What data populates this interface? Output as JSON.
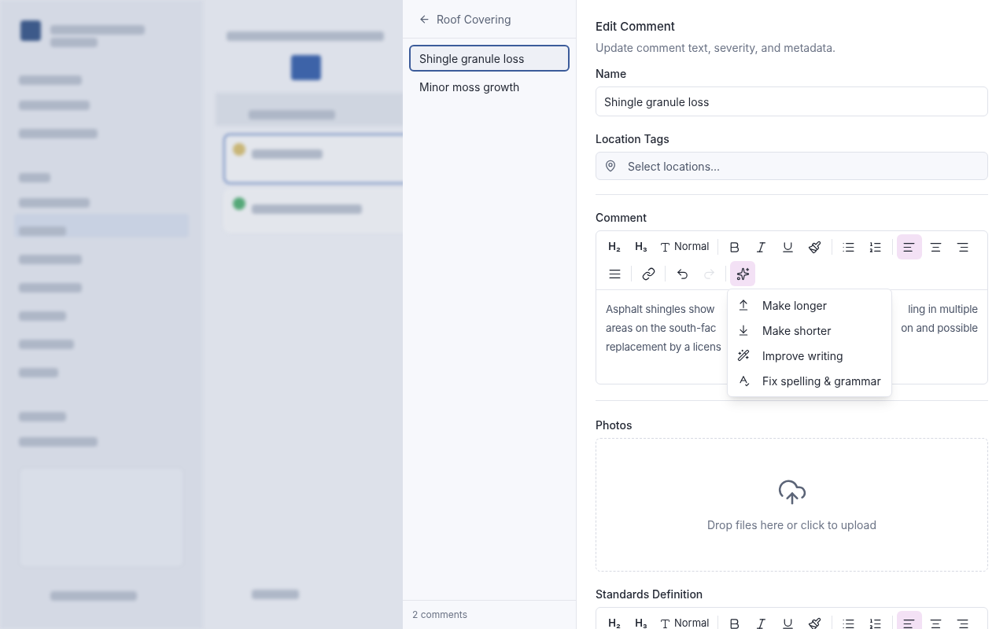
{
  "list_panel": {
    "back_label": "Roof Covering",
    "items": [
      {
        "label": "Shingle granule loss",
        "selected": true
      },
      {
        "label": "Minor moss growth",
        "selected": false
      }
    ],
    "footer": "2 comments"
  },
  "editor": {
    "title": "Edit Comment",
    "subtitle": "Update comment text, severity, and metadata.",
    "name_field": {
      "label": "Name",
      "value": "Shingle granule loss"
    },
    "location_field": {
      "label": "Location Tags",
      "placeholder": "Select locations..."
    },
    "comment": {
      "label": "Comment",
      "toolbar": [
        {
          "kind": "h2",
          "text": "H₂",
          "selected": false,
          "disabled": false
        },
        {
          "kind": "h3",
          "text": "H₃",
          "selected": false,
          "disabled": false
        },
        {
          "kind": "normal",
          "text": "Normal",
          "selected": false,
          "disabled": false
        },
        {
          "kind": "sep"
        },
        {
          "kind": "bold",
          "selected": false,
          "disabled": false
        },
        {
          "kind": "italic",
          "selected": false,
          "disabled": false
        },
        {
          "kind": "underline",
          "selected": false,
          "disabled": false
        },
        {
          "kind": "brush",
          "selected": false,
          "disabled": false
        },
        {
          "kind": "sep"
        },
        {
          "kind": "bullets",
          "selected": false,
          "disabled": false
        },
        {
          "kind": "numbers",
          "selected": false,
          "disabled": false
        },
        {
          "kind": "sep"
        },
        {
          "kind": "align-left",
          "selected": true,
          "disabled": false
        },
        {
          "kind": "align-center",
          "selected": false,
          "disabled": false
        },
        {
          "kind": "align-right",
          "selected": false,
          "disabled": false
        },
        {
          "kind": "justify",
          "selected": false,
          "disabled": false
        },
        {
          "kind": "sep"
        },
        {
          "kind": "link",
          "selected": false,
          "disabled": false
        },
        {
          "kind": "sep"
        },
        {
          "kind": "undo",
          "selected": false,
          "disabled": false
        },
        {
          "kind": "redo",
          "selected": false,
          "disabled": true
        },
        {
          "kind": "sep"
        },
        {
          "kind": "ai",
          "selected": true,
          "disabled": false
        }
      ],
      "text_lines": [
        "Asphalt shingles show",
        "ling in multiple",
        "areas on the south-fac",
        "on and possible",
        "replacement by a licens"
      ],
      "menu": [
        {
          "kind": "longer",
          "label": "Make longer"
        },
        {
          "kind": "shorter",
          "label": "Make shorter"
        },
        {
          "kind": "improve",
          "label": "Improve writing"
        },
        {
          "kind": "spelling",
          "label": "Fix spelling & grammar"
        }
      ]
    },
    "photos": {
      "label": "Photos",
      "hint": "Drop files here or click to upload"
    },
    "standards": {
      "label": "Standards Definition",
      "toolbar": [
        {
          "kind": "h2",
          "text": "H₂",
          "selected": false,
          "disabled": false
        },
        {
          "kind": "h3",
          "text": "H₃",
          "selected": false,
          "disabled": false
        },
        {
          "kind": "normal",
          "text": "Normal",
          "selected": false,
          "disabled": false
        },
        {
          "kind": "sep"
        },
        {
          "kind": "bold",
          "selected": false,
          "disabled": false
        },
        {
          "kind": "italic",
          "selected": false,
          "disabled": false
        },
        {
          "kind": "underline",
          "selected": false,
          "disabled": false
        },
        {
          "kind": "brush",
          "selected": false,
          "disabled": false
        },
        {
          "kind": "sep"
        },
        {
          "kind": "bullets",
          "selected": false,
          "disabled": false
        },
        {
          "kind": "numbers",
          "selected": false,
          "disabled": false
        },
        {
          "kind": "sep"
        },
        {
          "kind": "align-left",
          "selected": true,
          "disabled": false
        },
        {
          "kind": "align-center",
          "selected": false,
          "disabled": false
        },
        {
          "kind": "align-right",
          "selected": false,
          "disabled": false
        }
      ]
    }
  }
}
